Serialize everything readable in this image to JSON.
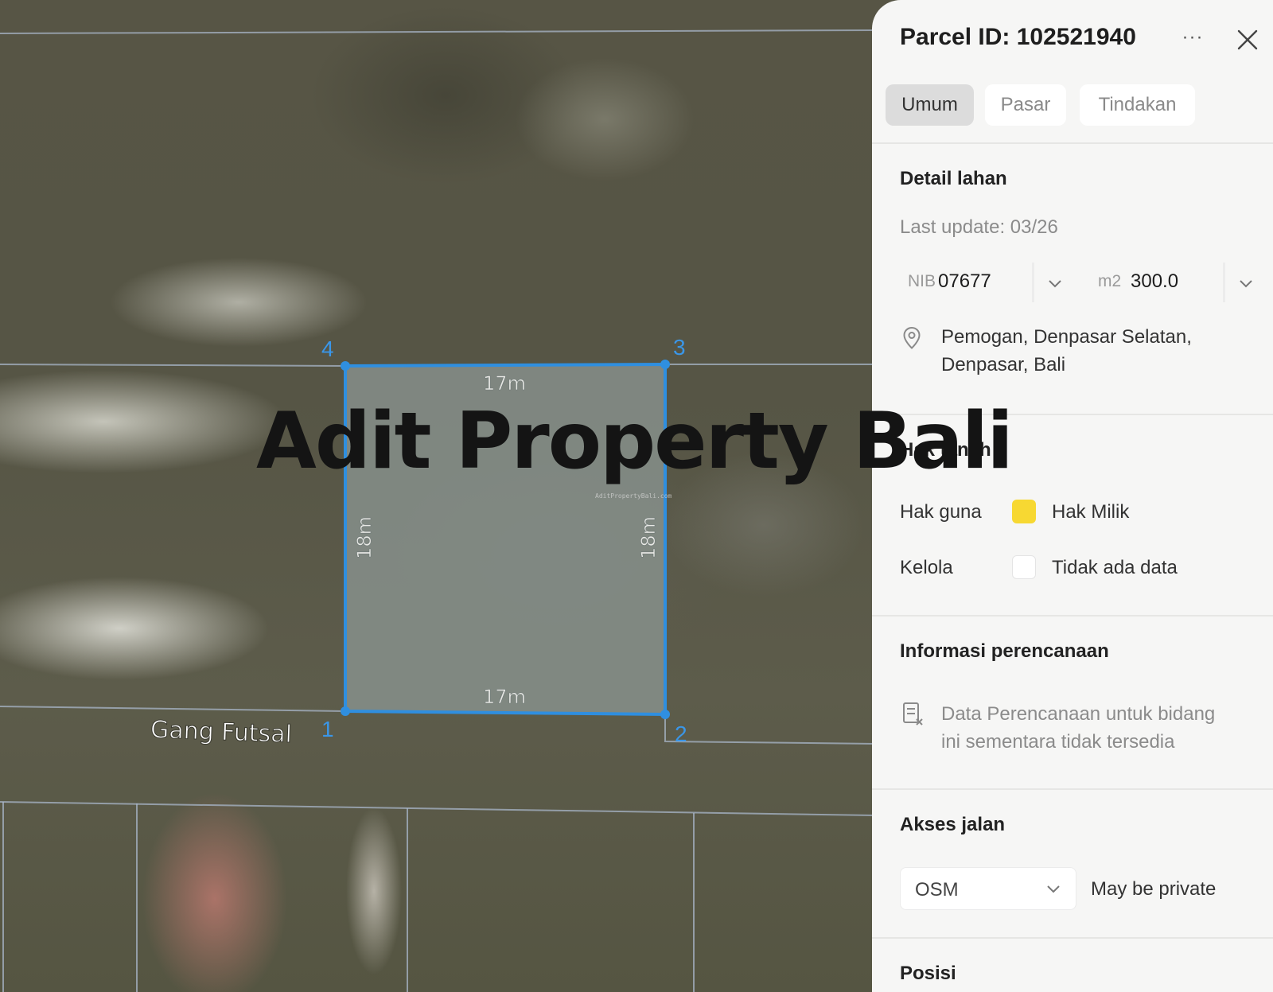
{
  "map": {
    "parcel_vertices": [
      "1",
      "2",
      "3",
      "4"
    ],
    "edges": {
      "top": "17m",
      "bottom": "17m",
      "left": "18m",
      "right": "18m"
    },
    "road_label": "Gang Futsal",
    "boundary_color": "#2f8fe0",
    "watermark": "Adit Property Bali",
    "watermark_small": "AditPropertyBali.com"
  },
  "panel": {
    "title": "Parcel ID: 102521940",
    "more_icon": "···",
    "tabs": [
      {
        "label": "Umum",
        "active": true
      },
      {
        "label": "Pasar",
        "active": false
      },
      {
        "label": "Tindakan",
        "active": false
      }
    ],
    "land_detail": {
      "heading": "Detail lahan",
      "last_update": "Last update: 03/26",
      "nib_label": "NIB",
      "nib_value": "07677",
      "area_label": "m2",
      "area_value": "300.0",
      "address_line1": "Pemogan, Denpasar Selatan,",
      "address_line2": "Denpasar, Bali"
    },
    "rights": {
      "heading": "Hak tanah",
      "rows": [
        {
          "label": "Hak guna",
          "value": "Hak Milik",
          "color": "#f7d832"
        },
        {
          "label": "Kelola",
          "value": "Tidak ada data",
          "color": "#ffffff"
        }
      ]
    },
    "planning": {
      "heading": "Informasi perencanaan",
      "line1": "Data Perencanaan untuk bidang",
      "line2": "ini sementara tidak tersedia"
    },
    "road_access": {
      "heading": "Akses jalan",
      "source": "OSM",
      "note": "May be private"
    },
    "position": {
      "heading": "Posisi"
    }
  }
}
